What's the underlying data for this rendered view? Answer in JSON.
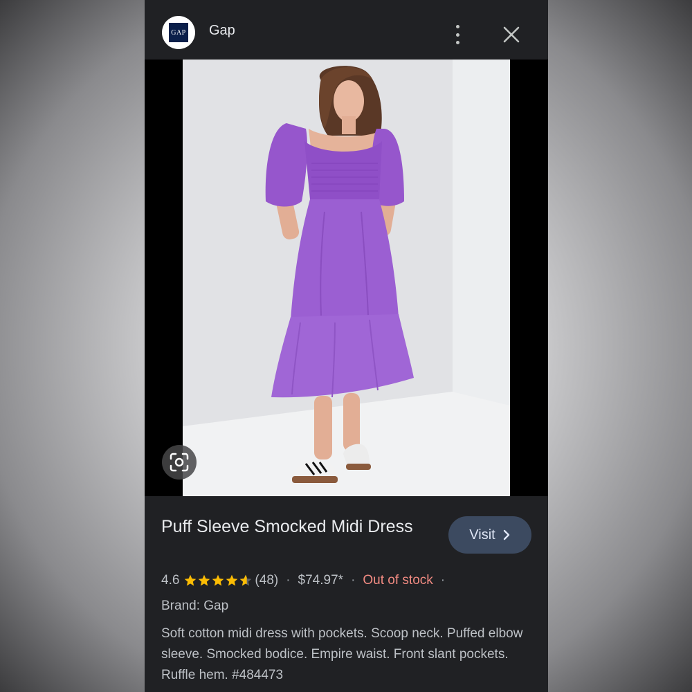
{
  "header": {
    "logo_text": "GAP",
    "brand": "Gap"
  },
  "product": {
    "title": "Puff Sleeve Smocked Midi Dress",
    "visit_label": "Visit",
    "rating": "4.6",
    "rating_stars": 4.6,
    "reviews": "(48)",
    "price": "$74.97*",
    "stock": "Out of stock",
    "brand_line": "Brand: Gap",
    "description": "Soft cotton midi dress with pockets. Scoop neck. Puffed elbow sleeve. Smocked bodice. Empire waist. Front slant pockets. Ruffle hem. #484473"
  },
  "colors": {
    "background": "#202124",
    "dress": "#9b5fd2",
    "visit_button": "#3c4a60",
    "star": "#fbbc04",
    "out_of_stock": "#f28b82"
  },
  "icons": [
    "more-vert-icon",
    "close-icon",
    "lens-search-icon",
    "star-icon",
    "chevron-right-icon"
  ]
}
